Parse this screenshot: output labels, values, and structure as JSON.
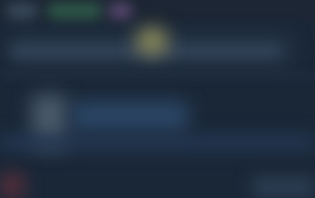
{
  "screen": {
    "background_color": "#1a2737",
    "note_visible_text": ""
  },
  "colors": {
    "topbar": "#1c2634",
    "accent_green": "#2f5a48",
    "accent_purple": "#5a4870",
    "accent_yellow": "#8c8a5a",
    "panel_blue": "#2b4665",
    "footer_red": "#5a2f3a"
  },
  "icons": {
    "top_left": "app-icon",
    "top_middle": "tab-icon",
    "top_right": "avatar-icon",
    "glow": "highlight-icon",
    "thumb": "image-icon",
    "footer_left": "badge-icon"
  }
}
